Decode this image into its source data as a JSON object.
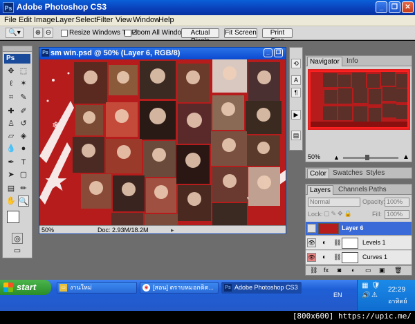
{
  "app": {
    "title": "Adobe Photoshop CS3",
    "icon_label": "Ps",
    "window_buttons": [
      "minimize",
      "restore",
      "close"
    ]
  },
  "menu": [
    "File",
    "Edit",
    "Image",
    "Layer",
    "Select",
    "Filter",
    "View",
    "Window",
    "Help"
  ],
  "options_bar": {
    "resize_windows_label": "Resize Windows To Fit",
    "zoom_all_label": "Zoom All Windows",
    "resize_checked": false,
    "zoom_all_checked": false,
    "buttons": [
      "Actual Pixels",
      "Fit Screen",
      "Print Size"
    ]
  },
  "tools": {
    "logo": "Ps"
  },
  "document": {
    "title": "sm win.psd @ 50% (Layer 6, RGB/8)",
    "zoom": "50%",
    "doc_size": "Doc: 2.93M/18.2M"
  },
  "navigator": {
    "tabs": [
      "Navigator",
      "Info"
    ],
    "zoom": "50%"
  },
  "color_panel": {
    "tabs": [
      "Color",
      "Swatches",
      "Styles"
    ]
  },
  "layers": {
    "tabs": [
      "Layers",
      "Channels",
      "Paths"
    ],
    "blend_mode": "Normal",
    "opacity_label": "Opacity:",
    "opacity": "100%",
    "lock_label": "Lock:",
    "fill_label": "Fill:",
    "fill": "100%",
    "rows": [
      {
        "name": "Layer 6",
        "selected": true
      },
      {
        "name": "Levels 1",
        "selected": false
      },
      {
        "name": "Curves 1",
        "selected": false
      }
    ]
  },
  "taskbar": {
    "start_label": "start",
    "items": [
      {
        "label": "งานใหม่",
        "icon": "folder-icon"
      },
      {
        "label": "[สอน] ตราบหมอกดิต...",
        "icon": "chrome-icon"
      },
      {
        "label": "Adobe Photoshop CS3",
        "icon": "photoshop-icon",
        "active": true
      }
    ],
    "language": "EN",
    "clock": "22:29",
    "day": "อาทิตย์"
  },
  "watermark": "[800x600] https://upic.me/",
  "colors": {
    "canvas_red": "#b71c1c",
    "xp_blue": "#245edb",
    "layer_selected": "#3a6ad8",
    "workspace_gray": "#6d6d6d"
  }
}
